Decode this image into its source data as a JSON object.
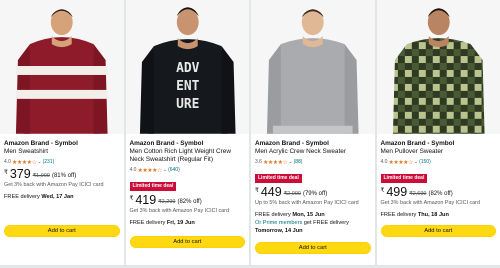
{
  "products": [
    {
      "brand": "Amazon Brand - Symbol",
      "title": "Men Sweatshirt",
      "rating": "4.0",
      "review_count": "(231)",
      "deal_badge": "",
      "currency": "₹",
      "price": "379",
      "mrp": "₹1,999",
      "discount": "(81% off)",
      "cashback": "Get 3% back with Amazon Pay ICICI card",
      "delivery_prefix": "FREE delivery ",
      "delivery_date": "Wed, 17 Jan",
      "prime_text": "",
      "prime_suffix": "",
      "prime_date": "",
      "add_to_cart": "Add to cart",
      "colors": {
        "main": "#8e1b2a",
        "stripe": "#f2eeea"
      }
    },
    {
      "brand": "Amazon Brand - Symbol",
      "title": "Men Cotton Rich Light Weight Crew Neck Sweatshirt (Regular Fit)",
      "rating": "4.0",
      "review_count": "(640)",
      "deal_badge": "Limited time deal",
      "currency": "₹",
      "price": "419",
      "mrp": "₹2,299",
      "discount": "(82% off)",
      "cashback": "Get 3% back with Amazon Pay ICICI card",
      "delivery_prefix": "FREE delivery ",
      "delivery_date": "Fri, 19 Jun",
      "prime_text": "",
      "prime_suffix": "",
      "prime_date": "",
      "add_to_cart": "Add to cart",
      "print_text": [
        "ADV",
        "ENT",
        "URE"
      ],
      "colors": {
        "main": "#15181c",
        "stripe": "#e8e8e8"
      }
    },
    {
      "brand": "Amazon Brand - Symbol",
      "title": "Men Acrylic Crew Neck Sweater",
      "rating": "3.6",
      "review_count": "(88)",
      "deal_badge": "Limited time deal",
      "currency": "₹",
      "price": "449",
      "mrp": "₹2,099",
      "discount": "(79% off)",
      "cashback": "Up to 5% back with Amazon Pay ICICI card",
      "delivery_prefix": "FREE delivery ",
      "delivery_date": "Mon, 15 Jun",
      "prime_text": "Or Prime members",
      "prime_suffix": " get FREE delivery",
      "prime_date": "Tomorrow, 14 Jun",
      "add_to_cart": "Add to cart",
      "colors": {
        "main": "#a9abae",
        "stripe": "#c3c5c7"
      }
    },
    {
      "brand": "Amazon Brand - Symbol",
      "title": "Men Pullover Sweater",
      "rating": "4.0",
      "review_count": "(150)",
      "deal_badge": "Limited time deal",
      "currency": "₹",
      "price": "499",
      "mrp": "₹2,699",
      "discount": "(82% off)",
      "cashback": "Get 3% back with Amazon Pay ICICI card",
      "delivery_prefix": "FREE delivery ",
      "delivery_date": "Thu, 18 Jun",
      "prime_text": "",
      "prime_suffix": "",
      "prime_date": "",
      "add_to_cart": "Add to cart",
      "colors": {
        "main": "#2f3a23",
        "stripe": "#b9c48e"
      }
    }
  ],
  "stars_glyph": "★★★★☆",
  "chevron_glyph": "⌄"
}
